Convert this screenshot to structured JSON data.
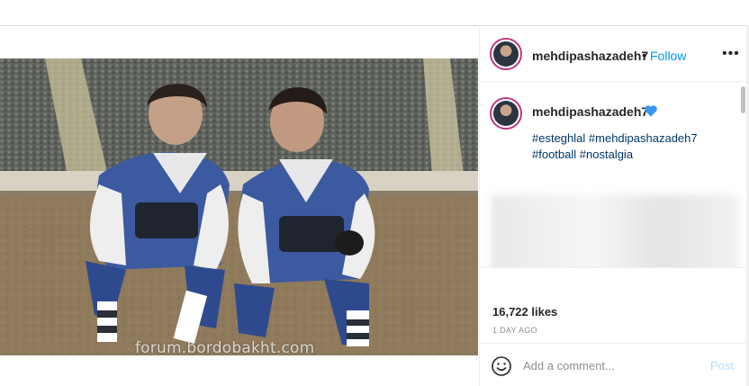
{
  "post": {
    "username": "mehdipashazadeh7",
    "follow_label": "Follow",
    "dot": "•",
    "more_label": "•••",
    "hashtags": [
      "#esteghlal",
      "#mehdipashazadeh7",
      "#football",
      "#nostalgia"
    ],
    "likes": "16,722 likes",
    "timestamp": "1 DAY AGO",
    "heart_color": "#3897f0"
  },
  "media": {
    "watermark": "forum.bordobakht.com"
  },
  "comment": {
    "placeholder": "Add a comment...",
    "post_label": "Post"
  },
  "icons": {
    "more": "more-options-icon",
    "heart": "blue-heart-icon",
    "emoji": "smile-icon"
  },
  "colors": {
    "link": "#0095f6",
    "hashtag": "#00376b",
    "post_disabled": "#b2dffc"
  }
}
